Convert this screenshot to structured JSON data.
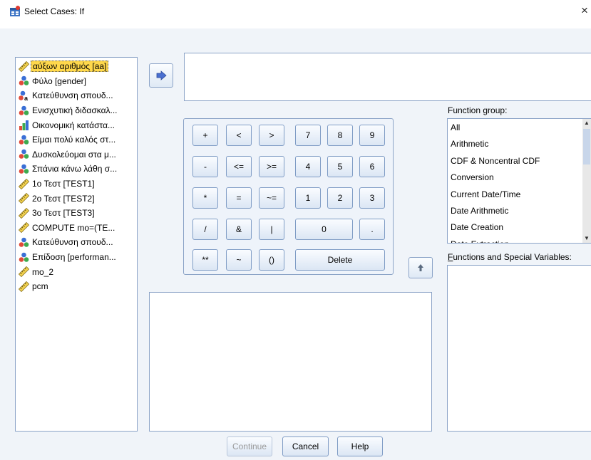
{
  "window": {
    "title": "Select Cases: If",
    "close_glyph": "×"
  },
  "variables": [
    {
      "label": "αύξων αριθμός [aa]",
      "icon": "scale-ruler-icon",
      "selected": true
    },
    {
      "label": "Φύλο [gender]",
      "icon": "nominal-icon"
    },
    {
      "label": "Κατεύθυνση σπουδ...",
      "icon": "nominal-string-icon"
    },
    {
      "label": "Ενισχυτική διδασκαλ...",
      "icon": "nominal-icon"
    },
    {
      "label": "Οικονομική κατάστα...",
      "icon": "ordinal-icon"
    },
    {
      "label": "Είμαι πολύ καλός στ...",
      "icon": "nominal-icon"
    },
    {
      "label": "Δυσκολεύομαι στα μ...",
      "icon": "nominal-icon"
    },
    {
      "label": "Σπάνια κάνω λάθη σ...",
      "icon": "nominal-icon"
    },
    {
      "label": "1o Τεστ [TEST1]",
      "icon": "scale-ruler-icon"
    },
    {
      "label": "2o Τεστ [TEST2]",
      "icon": "scale-ruler-icon"
    },
    {
      "label": "3o Τεστ [TEST3]",
      "icon": "scale-ruler-icon"
    },
    {
      "label": "COMPUTE mo=(TE...",
      "icon": "scale-ruler-icon"
    },
    {
      "label": "Κατεύθυνση σπουδ...",
      "icon": "nominal-icon"
    },
    {
      "label": "Επίδοση [performan...",
      "icon": "nominal-icon"
    },
    {
      "label": "mo_2",
      "icon": "scale-ruler-icon"
    },
    {
      "label": "pcm",
      "icon": "scale-ruler-icon"
    }
  ],
  "keypad": {
    "plus": "+",
    "lt": "<",
    "gt": ">",
    "seven": "7",
    "eight": "8",
    "nine": "9",
    "minus": "-",
    "le": "<=",
    "ge": ">=",
    "four": "4",
    "five": "5",
    "six": "6",
    "multiply": "*",
    "eq": "=",
    "ne": "~=",
    "one": "1",
    "two": "2",
    "three": "3",
    "divide": "/",
    "and": "&",
    "or": "|",
    "zero": "0",
    "dot": ".",
    "power": "**",
    "not": "~",
    "parens": "()",
    "delete": "Delete"
  },
  "function_group": {
    "label_pre": "Function ",
    "label_mn": "g",
    "label_post": "roup:",
    "items": [
      "All",
      "Arithmetic",
      "CDF & Noncentral CDF",
      "Conversion",
      "Current Date/Time",
      "Date Arithmetic",
      "Date Creation",
      "Date Extraction"
    ]
  },
  "functions_special": {
    "label_mn": "F",
    "label_rest": "unctions and Special Variables:"
  },
  "buttons": {
    "continue": "Continue",
    "cancel": "Cancel",
    "help": "Help"
  },
  "colors": {
    "selection": "#ffd84c",
    "border": "#8ba3c7",
    "background": "#f0f4f9"
  }
}
